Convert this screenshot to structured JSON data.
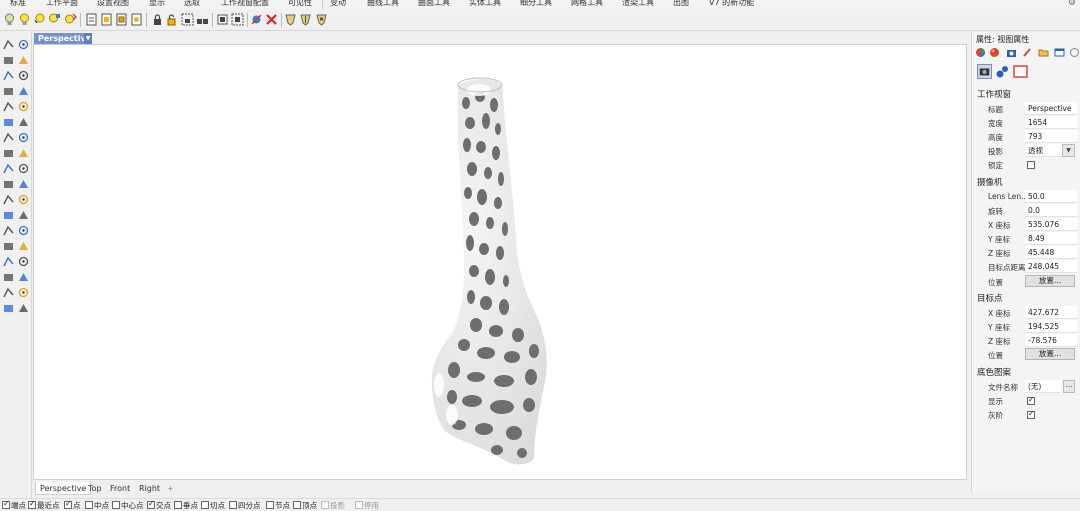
{
  "ribbon_tabs": [
    "标准",
    "工作平面",
    "设置视图",
    "显示",
    "选取",
    "工作视窗配置",
    "可见性",
    "变动",
    "曲线工具",
    "曲面工具",
    "实体工具",
    "细分工具",
    "网格工具",
    "渲染工具",
    "出图",
    "V7 的新功能"
  ],
  "active_tab": "可见性",
  "toolbar_icons": [
    "light-bulb-icon",
    "light-bulb-on-icon",
    "light-bulb-cursor-icon",
    "light-bulb-filter-icon",
    "document-icon",
    "document-color-icon",
    "document-layer-icon",
    "document-star-icon",
    "lock-icon",
    "lock-toggle-icon",
    "lock-select-icon",
    "lock-layer-icon",
    "grid-select-icon",
    "grid-dashed-icon",
    "swap-icon",
    "delete-icon",
    "shield-icon",
    "shield-pen-icon",
    "shield-select-icon"
  ],
  "viewport": {
    "title": "Perspective",
    "tabs": [
      "Perspective",
      "Top",
      "Front",
      "Right"
    ],
    "add_tab": "+"
  },
  "osnaps": [
    {
      "label": "端点",
      "checked": true
    },
    {
      "label": "最近点",
      "checked": true
    },
    {
      "label": "点",
      "checked": true
    },
    {
      "label": "中点",
      "checked": false
    },
    {
      "label": "中心点",
      "checked": false
    },
    {
      "label": "交点",
      "checked": true
    },
    {
      "label": "垂点",
      "checked": false
    },
    {
      "label": "切点",
      "checked": false
    },
    {
      "label": "四分点",
      "checked": false
    },
    {
      "label": "节点",
      "checked": false
    },
    {
      "label": "顶点",
      "checked": false
    },
    {
      "label": "投影",
      "checked": false,
      "disabled": true
    },
    {
      "label": "停用",
      "checked": false,
      "disabled": true
    }
  ],
  "panel": {
    "title": "属性: 视图属性",
    "viewport_section": "工作视窗",
    "camera_section": "摄像机",
    "target_section": "目标点",
    "wallpaper_section": "底色图案",
    "viewport_rows": [
      {
        "label": "标题",
        "value": "Perspective"
      },
      {
        "label": "宽度",
        "value": "1654"
      },
      {
        "label": "高度",
        "value": "793"
      },
      {
        "label": "投影",
        "value": "透视"
      },
      {
        "label": "锁定",
        "checked": false
      }
    ],
    "camera_rows": [
      {
        "label": "Lens Len...",
        "value": "50.0"
      },
      {
        "label": "旋转",
        "value": "0.0"
      },
      {
        "label": "X 座标",
        "value": "535.076"
      },
      {
        "label": "Y 座标",
        "value": "8.49"
      },
      {
        "label": "Z 座标",
        "value": "45.448"
      },
      {
        "label": "目标点距离",
        "value": "248.045"
      },
      {
        "label": "位置",
        "button": "放置..."
      }
    ],
    "target_rows": [
      {
        "label": "X 座标",
        "value": "427.672"
      },
      {
        "label": "Y 座标",
        "value": "194.525"
      },
      {
        "label": "Z 座标",
        "value": "-78.576"
      },
      {
        "label": "位置",
        "button": "放置..."
      }
    ],
    "wallpaper_rows": [
      {
        "label": "文件名称",
        "value": "(无)"
      },
      {
        "label": "显示",
        "checked": true
      },
      {
        "label": "灰阶",
        "checked": true
      }
    ]
  }
}
